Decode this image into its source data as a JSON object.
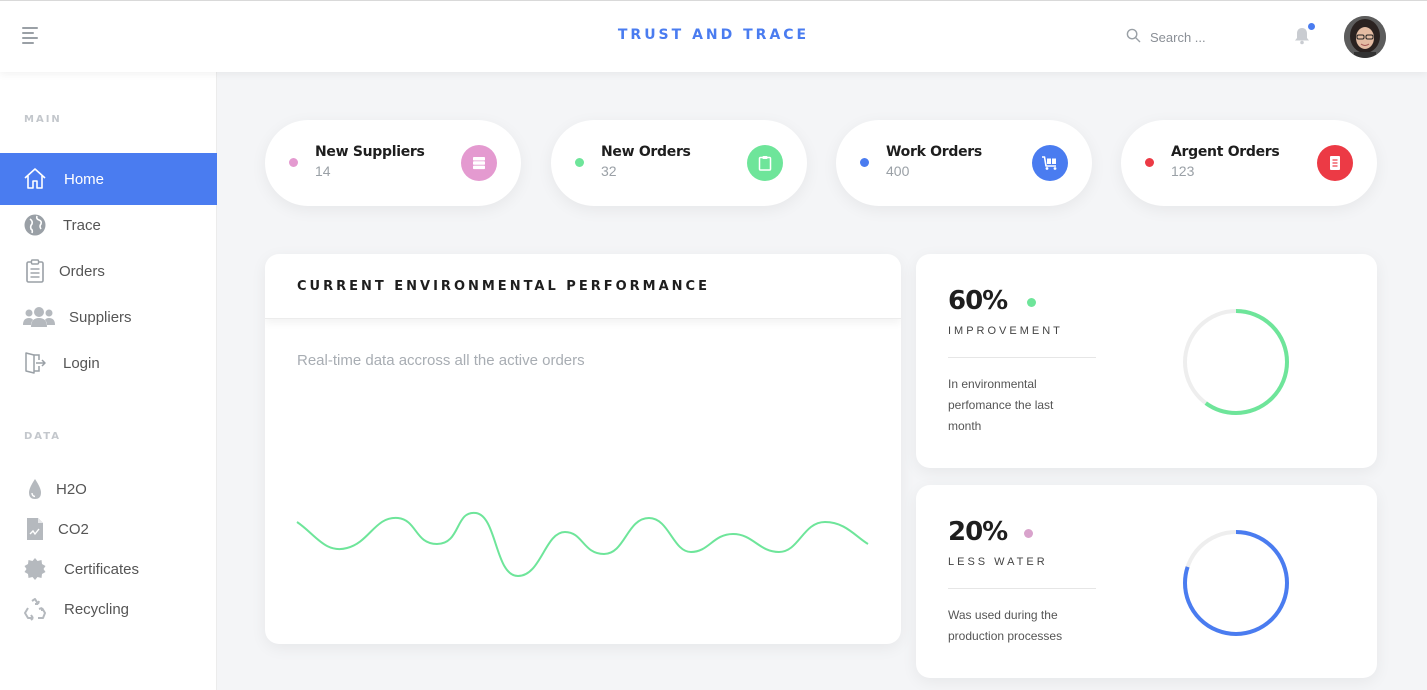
{
  "header": {
    "brand": "TRUST AND TRACE",
    "search_placeholder": "Search ...",
    "notification_dot_color": "#4a7cf0"
  },
  "sidebar": {
    "main_label": "MAIN",
    "data_label": "DATA",
    "main_items": [
      {
        "label": "Home",
        "icon": "home-icon",
        "active": true
      },
      {
        "label": "Trace",
        "icon": "globe-icon"
      },
      {
        "label": "Orders",
        "icon": "clipboard-icon"
      },
      {
        "label": "Suppliers",
        "icon": "users-icon"
      },
      {
        "label": "Login",
        "icon": "door-icon"
      }
    ],
    "data_items": [
      {
        "label": "H2O",
        "icon": "water-drop-icon"
      },
      {
        "label": "CO2",
        "icon": "document-chart-icon"
      },
      {
        "label": "Certificates",
        "icon": "certificate-icon"
      },
      {
        "label": "Recycling",
        "icon": "recycle-icon"
      }
    ]
  },
  "stats": [
    {
      "title": "New Suppliers",
      "count": "14",
      "color": "#e49ad0",
      "icon": "server-icon"
    },
    {
      "title": "New Orders",
      "count": "32",
      "color": "#6ee59a",
      "icon": "clipboard-icon"
    },
    {
      "title": "Work Orders",
      "count": "400",
      "color": "#4a7cf0",
      "icon": "cart-icon"
    },
    {
      "title": "Argent Orders",
      "count": "123",
      "color": "#ec3a45",
      "icon": "document-icon"
    }
  ],
  "performance": {
    "title": "CURRENT ENVIRONMENTAL PERFORMANCE",
    "subtitle": "Real-time data accross all the active orders",
    "line_color": "#6ee59a"
  },
  "metrics": [
    {
      "value": "60%",
      "label": "IMPROVEMENT",
      "description": "In environmental perfomance the last month",
      "dot_color": "#6ee59a",
      "ring_color": "#6ee59a",
      "progress": 0.6
    },
    {
      "value": "20%",
      "label": "LESS WATER",
      "description": "Was used during the production processes",
      "dot_color": "#d9a3cc",
      "ring_color": "#4a7cf0",
      "progress": 0.8
    }
  ]
}
